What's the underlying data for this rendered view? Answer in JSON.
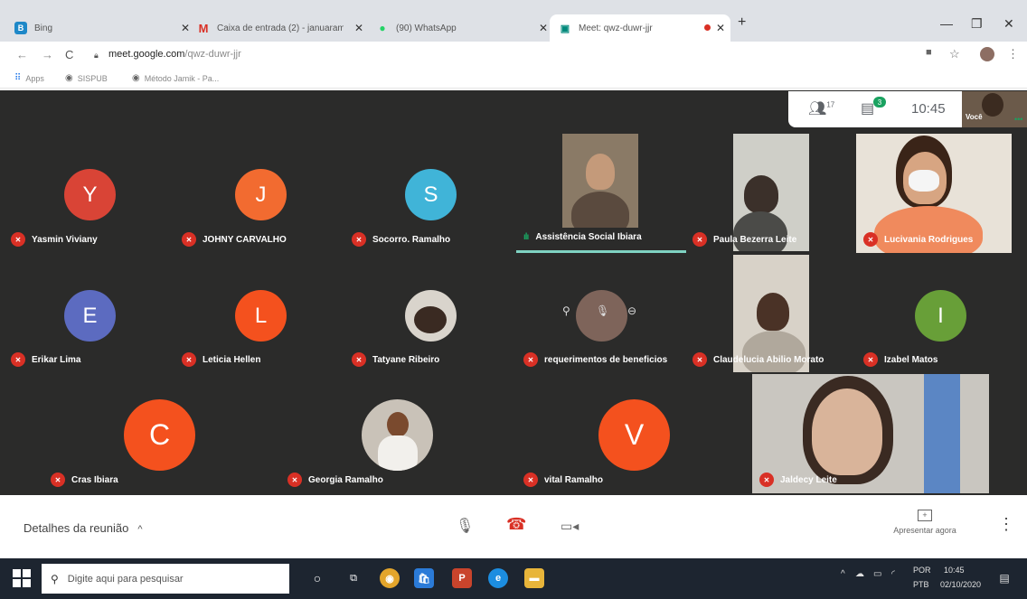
{
  "browser": {
    "tabs": [
      {
        "title": "Bing",
        "favicon": "B",
        "favicon_color": "#1e88c8"
      },
      {
        "title": "Caixa de entrada (2) - januaram",
        "favicon": "M",
        "favicon_color": "#d93025"
      },
      {
        "title": "(90) WhatsApp",
        "favicon": "●",
        "favicon_color": "#25d366"
      },
      {
        "title": "Meet: qwz-duwr-jjr",
        "favicon": "▣",
        "favicon_color": "#00897b"
      }
    ],
    "url_host": "meet.google.com",
    "url_path": "/qwz-duwr-jjr",
    "bookmarks": [
      "Apps",
      "SISPUB",
      "Método Jamik - Pa..."
    ]
  },
  "meet": {
    "participants_count": "17",
    "chat_badge": "3",
    "time": "10:45",
    "self_label": "Você",
    "tiles": [
      {
        "name": "Yasmin Viviany",
        "initial": "Y",
        "color": "#d94436"
      },
      {
        "name": "JOHNY CARVALHO",
        "initial": "J",
        "color": "#f26b30"
      },
      {
        "name": "Socorro. Ramalho",
        "initial": "S",
        "color": "#40b4d8"
      },
      {
        "name": "Assistência Social Ibiara"
      },
      {
        "name": "Paula Bezerra Leite"
      },
      {
        "name": "Lucivania Rodrigues"
      },
      {
        "name": "Erikar Lima",
        "initial": "E",
        "color": "#5c6bc0"
      },
      {
        "name": "Leticia Hellen",
        "initial": "L",
        "color": "#f4511e"
      },
      {
        "name": "Tatyane Ribeiro"
      },
      {
        "name": "requerimentos de beneficios"
      },
      {
        "name": "Claudelucia Abilio Morato"
      },
      {
        "name": "Izabel Matos",
        "initial": "I",
        "color": "#689f38"
      },
      {
        "name": "Cras Ibiara",
        "initial": "C",
        "color": "#f4511e"
      },
      {
        "name": "Georgia Ramalho"
      },
      {
        "name": "vital Ramalho",
        "initial": "V",
        "color": "#f4511e"
      },
      {
        "name": "Jaldecy Leite"
      }
    ],
    "details_label": "Detalhes da reunião",
    "present_label": "Apresentar agora"
  },
  "taskbar": {
    "search_placeholder": "Digite aqui para pesquisar",
    "lang_top": "POR",
    "lang_bottom": "PTB",
    "time": "10:45",
    "date": "02/10/2020"
  }
}
